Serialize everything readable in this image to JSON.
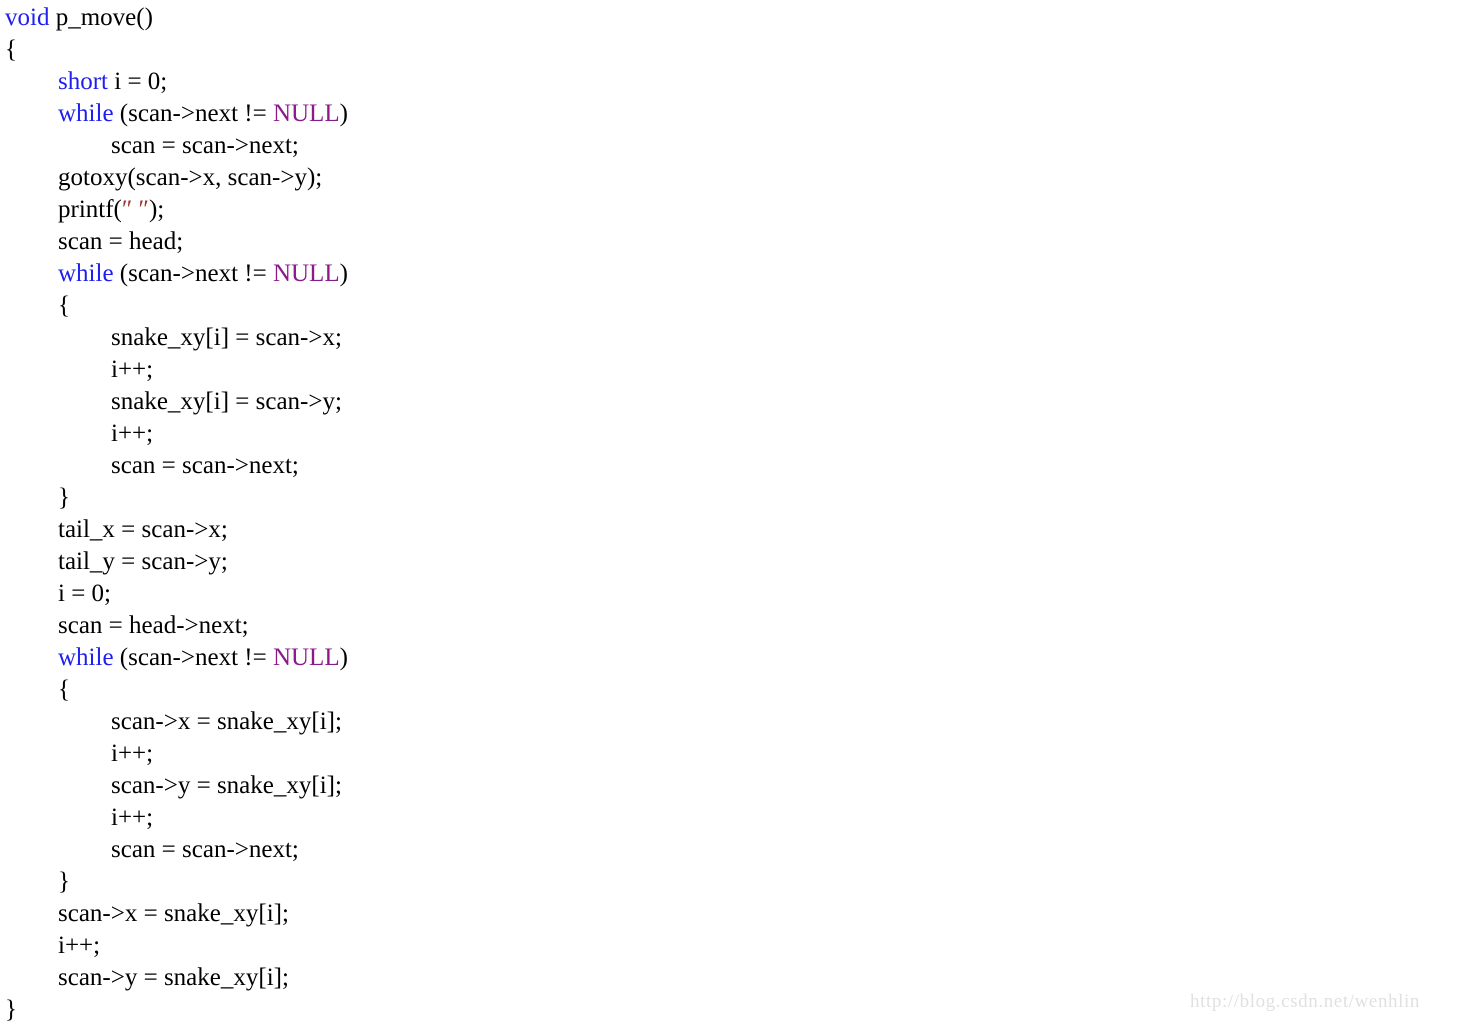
{
  "document": {
    "kind": "source-code-listing",
    "language": "C",
    "function_name": "p_move",
    "background_color": "#ffffff",
    "default_text_color": "#000000",
    "keyword_color": "#1f1fef",
    "macro_color": "#8b1a8b",
    "string_color": "#a0302a"
  },
  "watermark": {
    "text": "http://blog.csdn.net/wenhlin",
    "color": "#e2e0e0"
  },
  "code": {
    "lines": [
      {
        "indent": 0,
        "tokens": [
          {
            "t": "void",
            "c": "kw"
          },
          {
            "t": " p_move()",
            "c": "plain"
          }
        ]
      },
      {
        "indent": 0,
        "tokens": [
          {
            "t": "{",
            "c": "punct"
          }
        ]
      },
      {
        "indent": 1,
        "tokens": [
          {
            "t": "short",
            "c": "kw"
          },
          {
            "t": " i = 0;",
            "c": "plain"
          }
        ]
      },
      {
        "indent": 1,
        "tokens": [
          {
            "t": "while",
            "c": "kw"
          },
          {
            "t": " (scan->next != ",
            "c": "plain"
          },
          {
            "t": "NULL",
            "c": "macro"
          },
          {
            "t": ")",
            "c": "plain"
          }
        ]
      },
      {
        "indent": 2,
        "tokens": [
          {
            "t": "scan = scan->next;",
            "c": "plain"
          }
        ]
      },
      {
        "indent": 1,
        "tokens": [
          {
            "t": "gotoxy(scan->x, scan->y);",
            "c": "plain"
          }
        ]
      },
      {
        "indent": 1,
        "tokens": [
          {
            "t": "printf(",
            "c": "plain"
          },
          {
            "t": "″ ″",
            "c": "str"
          },
          {
            "t": ");",
            "c": "plain"
          }
        ]
      },
      {
        "indent": 1,
        "tokens": [
          {
            "t": "scan = head;",
            "c": "plain"
          }
        ]
      },
      {
        "indent": 1,
        "tokens": [
          {
            "t": "while",
            "c": "kw"
          },
          {
            "t": " (scan->next != ",
            "c": "plain"
          },
          {
            "t": "NULL",
            "c": "macro"
          },
          {
            "t": ")",
            "c": "plain"
          }
        ]
      },
      {
        "indent": 1,
        "tokens": [
          {
            "t": "{",
            "c": "punct"
          }
        ]
      },
      {
        "indent": 2,
        "tokens": [
          {
            "t": "snake_xy[i] = scan->x;",
            "c": "plain"
          }
        ]
      },
      {
        "indent": 2,
        "tokens": [
          {
            "t": "i++;",
            "c": "plain"
          }
        ]
      },
      {
        "indent": 2,
        "tokens": [
          {
            "t": "snake_xy[i] = scan->y;",
            "c": "plain"
          }
        ]
      },
      {
        "indent": 2,
        "tokens": [
          {
            "t": "i++;",
            "c": "plain"
          }
        ]
      },
      {
        "indent": 2,
        "tokens": [
          {
            "t": "scan = scan->next;",
            "c": "plain"
          }
        ]
      },
      {
        "indent": 1,
        "tokens": [
          {
            "t": "}",
            "c": "punct"
          }
        ]
      },
      {
        "indent": 1,
        "tokens": [
          {
            "t": "tail_x = scan->x;",
            "c": "plain"
          }
        ]
      },
      {
        "indent": 1,
        "tokens": [
          {
            "t": "tail_y = scan->y;",
            "c": "plain"
          }
        ]
      },
      {
        "indent": 1,
        "tokens": [
          {
            "t": "i = 0;",
            "c": "plain"
          }
        ]
      },
      {
        "indent": 1,
        "tokens": [
          {
            "t": "scan = head->next;",
            "c": "plain"
          }
        ]
      },
      {
        "indent": 1,
        "tokens": [
          {
            "t": "while",
            "c": "kw"
          },
          {
            "t": " (scan->next != ",
            "c": "plain"
          },
          {
            "t": "NULL",
            "c": "macro"
          },
          {
            "t": ")",
            "c": "plain"
          }
        ]
      },
      {
        "indent": 1,
        "tokens": [
          {
            "t": "{",
            "c": "punct"
          }
        ]
      },
      {
        "indent": 2,
        "tokens": [
          {
            "t": "scan->x = snake_xy[i];",
            "c": "plain"
          }
        ]
      },
      {
        "indent": 2,
        "tokens": [
          {
            "t": "i++;",
            "c": "plain"
          }
        ]
      },
      {
        "indent": 2,
        "tokens": [
          {
            "t": "scan->y = snake_xy[i];",
            "c": "plain"
          }
        ]
      },
      {
        "indent": 2,
        "tokens": [
          {
            "t": "i++;",
            "c": "plain"
          }
        ]
      },
      {
        "indent": 2,
        "tokens": [
          {
            "t": "scan = scan->next;",
            "c": "plain"
          }
        ]
      },
      {
        "indent": 1,
        "tokens": [
          {
            "t": "}",
            "c": "punct"
          }
        ]
      },
      {
        "indent": 1,
        "tokens": [
          {
            "t": "scan->x = snake_xy[i];",
            "c": "plain"
          }
        ]
      },
      {
        "indent": 1,
        "tokens": [
          {
            "t": "i++;",
            "c": "plain"
          }
        ]
      },
      {
        "indent": 1,
        "tokens": [
          {
            "t": "scan->y = snake_xy[i];",
            "c": "plain"
          }
        ]
      },
      {
        "indent": 0,
        "tokens": [
          {
            "t": "}",
            "c": "punct"
          }
        ]
      }
    ]
  }
}
